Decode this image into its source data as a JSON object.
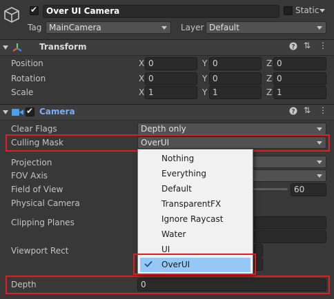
{
  "gameobject": {
    "name": "Over UI Camera",
    "static_label": "Static",
    "tag_label": "Tag",
    "tag_value": "MainCamera",
    "layer_label": "Layer",
    "layer_value": "Default"
  },
  "transform": {
    "title": "Transform",
    "rows": [
      {
        "label": "Position",
        "x": "0",
        "y": "0",
        "z": "0"
      },
      {
        "label": "Rotation",
        "x": "0",
        "y": "0",
        "z": "0"
      },
      {
        "label": "Scale",
        "x": "1",
        "y": "1",
        "z": "1"
      }
    ],
    "axis_x": "X",
    "axis_y": "Y",
    "axis_z": "Z"
  },
  "camera": {
    "title": "Camera",
    "clear_flags_label": "Clear Flags",
    "clear_flags_value": "Depth only",
    "culling_mask_label": "Culling Mask",
    "culling_mask_value": "OverUI",
    "projection_label": "Projection",
    "fov_axis_label": "FOV Axis",
    "field_of_view_label": "Field of View",
    "field_of_view_value": "60",
    "physical_camera_label": "Physical Camera",
    "clipping_planes_label": "Clipping Planes",
    "viewport_rect_label": "Viewport Rect",
    "depth_label": "Depth",
    "depth_value": "0"
  },
  "culling_mask_popup": {
    "items": [
      "Nothing",
      "Everything",
      "Default",
      "TransparentFX",
      "Ignore Raycast",
      "Water",
      "UI",
      "OverUI"
    ],
    "selected": "OverUI"
  },
  "icons": [
    "cube-icon",
    "transform-axes-icon",
    "camera-icon",
    "help-icon",
    "presets-icon",
    "kebab-menu-icon",
    "foldout-arrow-icon",
    "dropdown-caret-icon",
    "checkmark-icon"
  ],
  "colors": {
    "background": "#383838",
    "header": "#3e3e3e",
    "highlight_red": "#e01e24",
    "selected_item": "#96c8f5",
    "camera_title": "#7ab0f0"
  }
}
